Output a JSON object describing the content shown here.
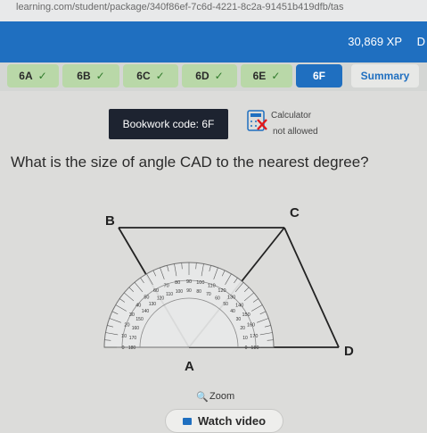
{
  "browser": {
    "url": "learning.com/student/package/340f86ef-7c6d-4221-8c2a-91451b419dfb/tas"
  },
  "header": {
    "xp": "30,869 XP",
    "trailing": "D"
  },
  "tabs": [
    {
      "label": "6A",
      "completed": "✓"
    },
    {
      "label": "6B",
      "completed": "✓"
    },
    {
      "label": "6C",
      "completed": "✓"
    },
    {
      "label": "6D",
      "completed": "✓"
    },
    {
      "label": "6E",
      "completed": "✓"
    },
    {
      "label": "6F"
    },
    {
      "label": "Summary"
    }
  ],
  "bookwork": {
    "label": "Bookwork code: 6F"
  },
  "calculator": {
    "label": "Calculator",
    "status": "not allowed"
  },
  "question": {
    "text": "What is the size of angle CAD to the nearest degree?"
  },
  "diagram": {
    "labels": {
      "B": "B",
      "C": "C",
      "A": "A",
      "D": "D"
    },
    "outer_scale": [
      "0",
      "10",
      "20",
      "30",
      "40",
      "50",
      "60",
      "70",
      "80",
      "90",
      "100",
      "110",
      "120",
      "130",
      "140",
      "150",
      "160",
      "170",
      "180"
    ],
    "inner_scale": [
      "180",
      "170",
      "160",
      "150",
      "140",
      "130",
      "120",
      "110",
      "100",
      "90",
      "80",
      "70",
      "60",
      "50",
      "40",
      "30",
      "20",
      "10",
      "0"
    ]
  },
  "zoom": {
    "label": "Zoom"
  },
  "video": {
    "label": "Watch video"
  },
  "colors": {
    "header_blue": "#1f6fc0",
    "tab_green": "#b9d8a8",
    "bookwork_dark": "#1d2330"
  }
}
